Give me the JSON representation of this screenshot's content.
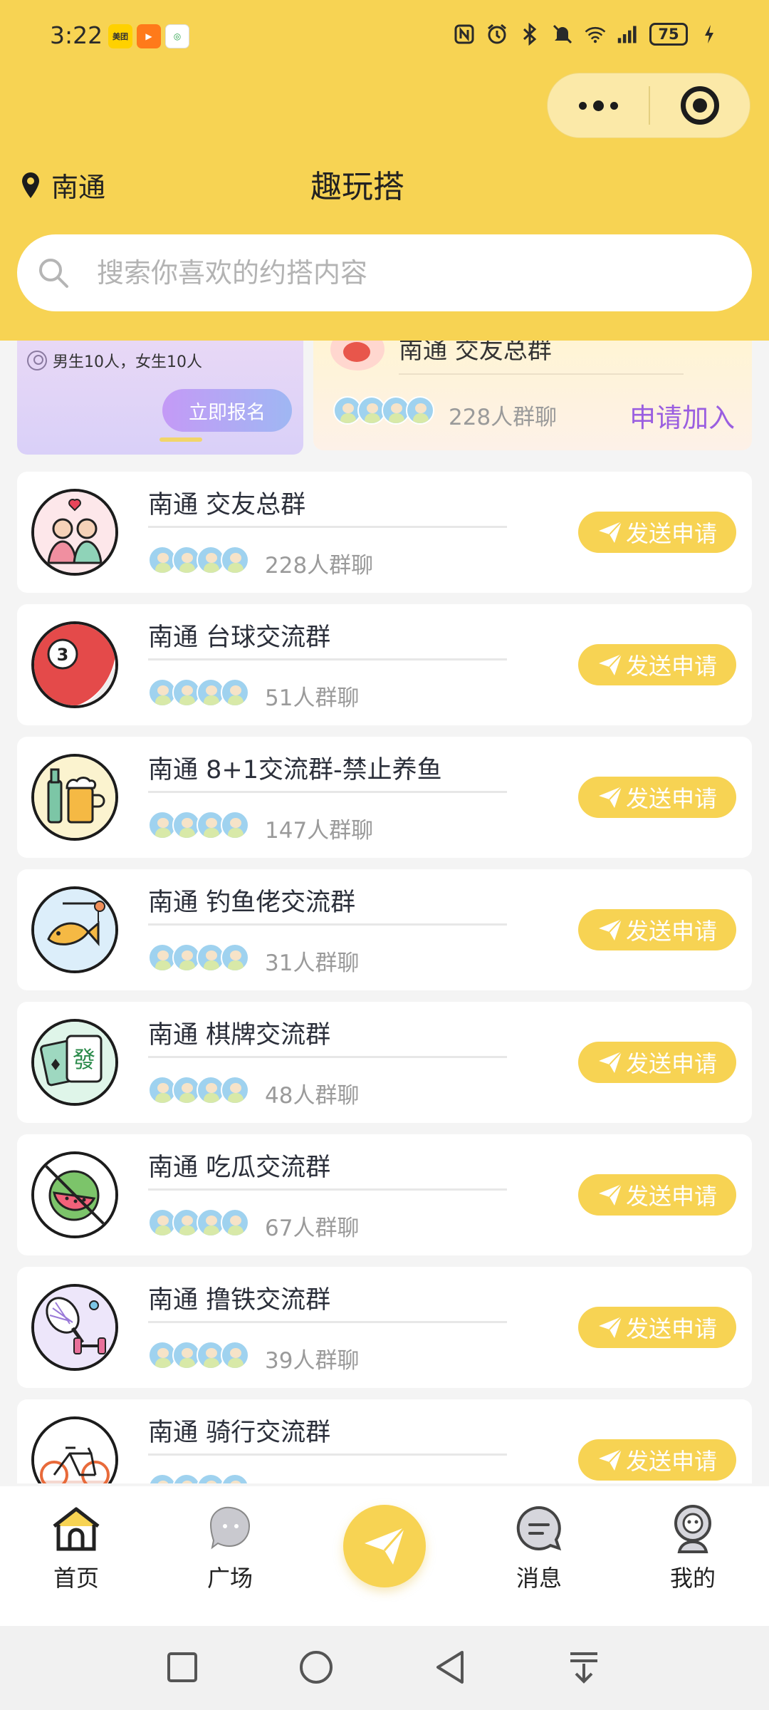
{
  "status_bar": {
    "time": "3:22",
    "battery": "75",
    "app_icons": [
      "meituan-icon",
      "video-app-icon",
      "china-mobile-icon"
    ],
    "system_icons": [
      "nfc-icon",
      "alarm-icon",
      "bluetooth-icon",
      "mute-icon",
      "wifi-icon",
      "signal-icon"
    ]
  },
  "header": {
    "location": "南通",
    "title": "趣玩搭",
    "search_placeholder": "搜索你喜欢的约搭内容"
  },
  "banner_left": {
    "gender_text": "男生10人，女生10人",
    "signup_label": "立即报名"
  },
  "banner_right": {
    "title": "南通 交友总群",
    "count": "228人群聊",
    "join_label": "申请加入"
  },
  "groups": [
    {
      "name": "南通 交友总群",
      "count": "228人群聊",
      "icon": "friends-icon",
      "button": "发送申请"
    },
    {
      "name": "南通 台球交流群",
      "count": "51人群聊",
      "icon": "billiard-ball-icon",
      "button": "发送申请"
    },
    {
      "name": "南通 8+1交流群-禁止养鱼",
      "count": "147人群聊",
      "icon": "beer-icon",
      "button": "发送申请"
    },
    {
      "name": "南通 钓鱼佬交流群",
      "count": "31人群聊",
      "icon": "fishing-icon",
      "button": "发送申请"
    },
    {
      "name": "南通 棋牌交流群",
      "count": "48人群聊",
      "icon": "mahjong-cards-icon",
      "button": "发送申请"
    },
    {
      "name": "南通 吃瓜交流群",
      "count": "67人群聊",
      "icon": "watermelon-icon",
      "button": "发送申请"
    },
    {
      "name": "南通 撸铁交流群",
      "count": "39人群聊",
      "icon": "fitness-icon",
      "button": "发送申请"
    },
    {
      "name": "南通 骑行交流群",
      "count": "",
      "icon": "bicycle-icon",
      "button": "发送申请"
    }
  ],
  "tabbar": {
    "home": "首页",
    "square": "广场",
    "messages": "消息",
    "mine": "我的"
  },
  "colors": {
    "brand_yellow": "#f7d353",
    "join_purple": "#9a5ee0"
  }
}
